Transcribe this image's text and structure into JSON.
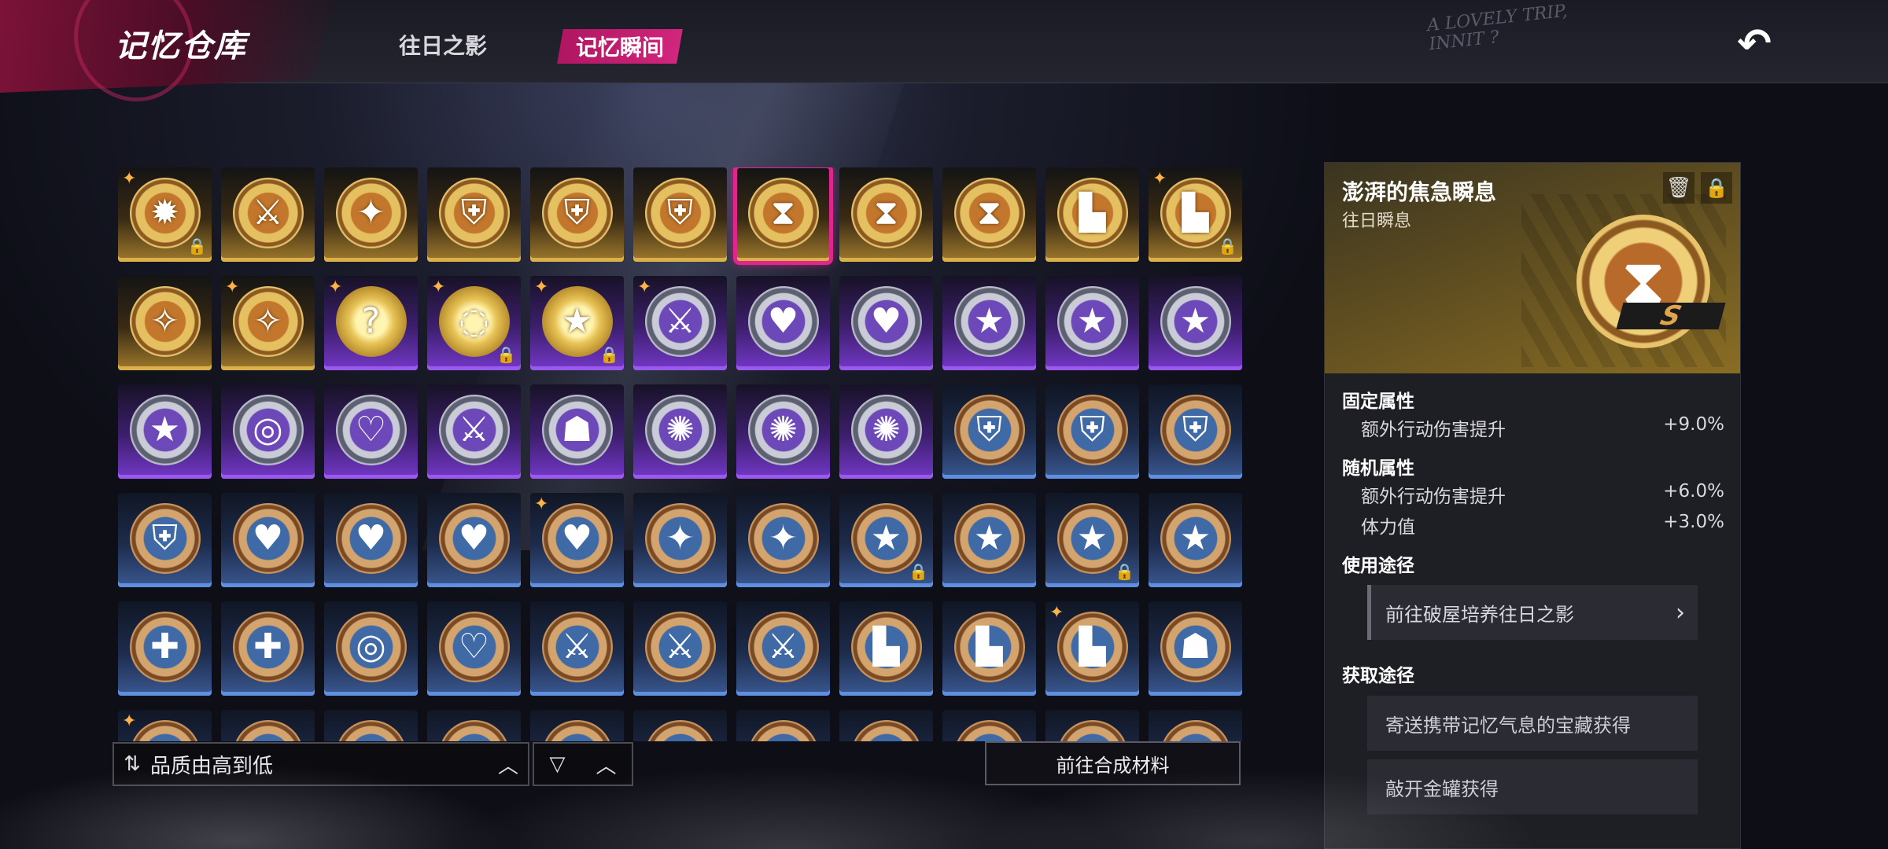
{
  "header": {
    "title": "记忆仓库",
    "tabs": [
      {
        "label": "往日之影",
        "active": false
      },
      {
        "label": "记忆瞬间",
        "active": true
      }
    ],
    "tagline_line1": "A LOVELY TRIP,",
    "tagline_line2": "INNIT ?",
    "back_icon": "back-arrow-icon"
  },
  "inventory": {
    "rows": [
      [
        {
          "quality": "gold",
          "icon": "star-burst-icon",
          "glyph": "✹",
          "spark": true,
          "lock": true
        },
        {
          "quality": "gold",
          "icon": "dagger-icon",
          "glyph": "⚔",
          "spark": false,
          "lock": false
        },
        {
          "quality": "gold",
          "icon": "claw-icon",
          "glyph": "✦",
          "spark": false,
          "lock": false
        },
        {
          "quality": "gold",
          "icon": "shield-icon",
          "glyph": "⛨",
          "spark": false,
          "lock": false
        },
        {
          "quality": "gold",
          "icon": "shield-icon",
          "glyph": "⛨",
          "spark": false,
          "lock": false
        },
        {
          "quality": "gold",
          "icon": "shield-icon",
          "glyph": "⛨",
          "spark": false,
          "lock": false
        },
        {
          "quality": "gold",
          "icon": "hourglass-icon",
          "glyph": "⧗",
          "spark": false,
          "lock": false,
          "selected": true
        },
        {
          "quality": "gold",
          "icon": "hourglass-icon",
          "glyph": "⧗",
          "spark": false,
          "lock": false
        },
        {
          "quality": "gold",
          "icon": "hourglass-icon",
          "glyph": "⧗",
          "spark": false,
          "lock": false
        },
        {
          "quality": "gold",
          "icon": "boot-icon",
          "glyph": "▙",
          "spark": false,
          "lock": false
        },
        {
          "quality": "gold",
          "icon": "boot-icon",
          "glyph": "▙",
          "spark": true,
          "lock": true
        }
      ],
      [
        {
          "quality": "gold",
          "icon": "compass-star-icon",
          "glyph": "✧",
          "spark": false,
          "lock": false
        },
        {
          "quality": "gold",
          "icon": "compass-star-icon",
          "glyph": "✧",
          "spark": true,
          "lock": false
        },
        {
          "quality": "purple-special",
          "icon": "question-mark-icon",
          "glyph": "?",
          "spark": true,
          "lock": false
        },
        {
          "quality": "purple-special",
          "icon": "gold-ring-icon",
          "glyph": "◌",
          "spark": true,
          "lock": true
        },
        {
          "quality": "purple-special",
          "icon": "gold-star-icon",
          "glyph": "★",
          "spark": true,
          "lock": true
        },
        {
          "quality": "purple",
          "icon": "dagger-icon",
          "glyph": "⚔",
          "spark": true,
          "lock": false
        },
        {
          "quality": "purple",
          "icon": "heart-icon",
          "glyph": "♥",
          "spark": false,
          "lock": false
        },
        {
          "quality": "purple",
          "icon": "broken-heart-icon",
          "glyph": "♥",
          "spark": false,
          "lock": false
        },
        {
          "quality": "purple",
          "icon": "star-icon",
          "glyph": "★",
          "spark": false,
          "lock": false
        },
        {
          "quality": "purple",
          "icon": "star-icon",
          "glyph": "★",
          "spark": false,
          "lock": false
        },
        {
          "quality": "purple",
          "icon": "star-icon",
          "glyph": "★",
          "spark": false,
          "lock": false
        }
      ],
      [
        {
          "quality": "purple",
          "icon": "star-icon",
          "glyph": "★",
          "spark": false,
          "lock": false
        },
        {
          "quality": "purple",
          "icon": "target-icon",
          "glyph": "◎",
          "spark": false,
          "lock": false
        },
        {
          "quality": "purple",
          "icon": "heart-ring-icon",
          "glyph": "♡",
          "spark": false,
          "lock": false
        },
        {
          "quality": "purple",
          "icon": "dagger-icon",
          "glyph": "⚔",
          "spark": false,
          "lock": false
        },
        {
          "quality": "purple",
          "icon": "bust-icon",
          "glyph": "☗",
          "spark": false,
          "lock": false
        },
        {
          "quality": "purple",
          "icon": "flame-icon",
          "glyph": "✺",
          "spark": false,
          "lock": false
        },
        {
          "quality": "purple",
          "icon": "flame-icon",
          "glyph": "✺",
          "spark": false,
          "lock": false
        },
        {
          "quality": "purple",
          "icon": "flame-icon",
          "glyph": "✺",
          "spark": false,
          "lock": false
        },
        {
          "quality": "blue",
          "icon": "shield-icon",
          "glyph": "⛨",
          "spark": false,
          "lock": false
        },
        {
          "quality": "blue",
          "icon": "shield-icon",
          "glyph": "⛨",
          "spark": false,
          "lock": false
        },
        {
          "quality": "blue",
          "icon": "shield-icon",
          "glyph": "⛨",
          "spark": false,
          "lock": false
        }
      ],
      [
        {
          "quality": "blue",
          "icon": "shield-icon",
          "glyph": "⛨",
          "spark": false,
          "lock": false
        },
        {
          "quality": "blue",
          "icon": "broken-heart-icon",
          "glyph": "♥",
          "spark": false,
          "lock": false
        },
        {
          "quality": "blue",
          "icon": "broken-heart-icon",
          "glyph": "♥",
          "spark": false,
          "lock": false
        },
        {
          "quality": "blue",
          "icon": "broken-heart-icon",
          "glyph": "♥",
          "spark": false,
          "lock": false
        },
        {
          "quality": "blue",
          "icon": "broken-heart-icon",
          "glyph": "♥",
          "spark": true,
          "lock": false
        },
        {
          "quality": "blue",
          "icon": "claw-icon",
          "glyph": "✦",
          "spark": false,
          "lock": false
        },
        {
          "quality": "blue",
          "icon": "claw-icon",
          "glyph": "✦",
          "spark": false,
          "lock": false
        },
        {
          "quality": "blue",
          "icon": "star-icon",
          "glyph": "★",
          "spark": false,
          "lock": true
        },
        {
          "quality": "blue",
          "icon": "star-icon",
          "glyph": "★",
          "spark": false,
          "lock": false
        },
        {
          "quality": "blue",
          "icon": "star-icon",
          "glyph": "★",
          "spark": false,
          "lock": true
        },
        {
          "quality": "blue",
          "icon": "star-icon",
          "glyph": "★",
          "spark": false,
          "lock": false
        }
      ],
      [
        {
          "quality": "blue",
          "icon": "plus-icon",
          "glyph": "✚",
          "spark": false,
          "lock": false
        },
        {
          "quality": "blue",
          "icon": "plus-icon",
          "glyph": "✚",
          "spark": false,
          "lock": false
        },
        {
          "quality": "blue",
          "icon": "target-icon",
          "glyph": "◎",
          "spark": false,
          "lock": false
        },
        {
          "quality": "blue",
          "icon": "heart-ring-icon",
          "glyph": "♡",
          "spark": false,
          "lock": false
        },
        {
          "quality": "blue",
          "icon": "dagger-icon",
          "glyph": "⚔",
          "spark": false,
          "lock": false
        },
        {
          "quality": "blue",
          "icon": "dagger-icon",
          "glyph": "⚔",
          "spark": false,
          "lock": false
        },
        {
          "quality": "blue",
          "icon": "dagger-icon",
          "glyph": "⚔",
          "spark": false,
          "lock": false
        },
        {
          "quality": "blue",
          "icon": "boot-icon",
          "glyph": "▙",
          "spark": false,
          "lock": false
        },
        {
          "quality": "blue",
          "icon": "boot-icon",
          "glyph": "▙",
          "spark": false,
          "lock": false
        },
        {
          "quality": "blue",
          "icon": "boot-icon",
          "glyph": "▙",
          "spark": true,
          "lock": false
        },
        {
          "quality": "blue",
          "icon": "bust-icon",
          "glyph": "☗",
          "spark": false,
          "lock": false
        }
      ],
      [
        {
          "quality": "blue",
          "icon": "medal-icon",
          "glyph": "",
          "spark": true,
          "lock": false
        },
        {
          "quality": "blue",
          "icon": "medal-icon",
          "glyph": "",
          "spark": false,
          "lock": false
        },
        {
          "quality": "blue",
          "icon": "medal-icon",
          "glyph": "",
          "spark": false,
          "lock": false
        },
        {
          "quality": "blue",
          "icon": "medal-icon",
          "glyph": "",
          "spark": false,
          "lock": false
        },
        {
          "quality": "blue",
          "icon": "medal-icon",
          "glyph": "",
          "spark": false,
          "lock": false
        },
        {
          "quality": "blue",
          "icon": "medal-icon",
          "glyph": "",
          "spark": false,
          "lock": false
        },
        {
          "quality": "blue",
          "icon": "medal-icon",
          "glyph": "",
          "spark": false,
          "lock": false
        },
        {
          "quality": "blue",
          "icon": "medal-icon",
          "glyph": "",
          "spark": false,
          "lock": false
        },
        {
          "quality": "blue",
          "icon": "medal-icon",
          "glyph": "",
          "spark": false,
          "lock": false
        },
        {
          "quality": "blue",
          "icon": "medal-icon",
          "glyph": "",
          "spark": false,
          "lock": false
        },
        {
          "quality": "blue",
          "icon": "medal-icon",
          "glyph": "",
          "spark": false,
          "lock": false
        }
      ]
    ]
  },
  "controls": {
    "sort_label": "品质由高到低",
    "craft_label": "前往合成材料"
  },
  "detail": {
    "name": "澎湃的焦急瞬息",
    "subtitle": "往日瞬息",
    "grade": "S",
    "fixed_title": "固定属性",
    "fixed_attrs": [
      {
        "name": "额外行动伤害提升",
        "value": "+9.0%"
      }
    ],
    "random_title": "随机属性",
    "random_attrs": [
      {
        "name": "额外行动伤害提升",
        "value": "+6.0%"
      },
      {
        "name": "体力值",
        "value": "+3.0%"
      }
    ],
    "usage_title": "使用途径",
    "usage_link": "前往破屋培养往日之影",
    "obtain_title": "获取途径",
    "obtain_sources": [
      "寄送携带记忆气息的宝藏获得",
      "敲开金罐获得"
    ]
  },
  "colors": {
    "accent": "#e0258c",
    "gold": "#d9b04a",
    "purple": "#9b59f0",
    "blue": "#5f8fe0"
  }
}
